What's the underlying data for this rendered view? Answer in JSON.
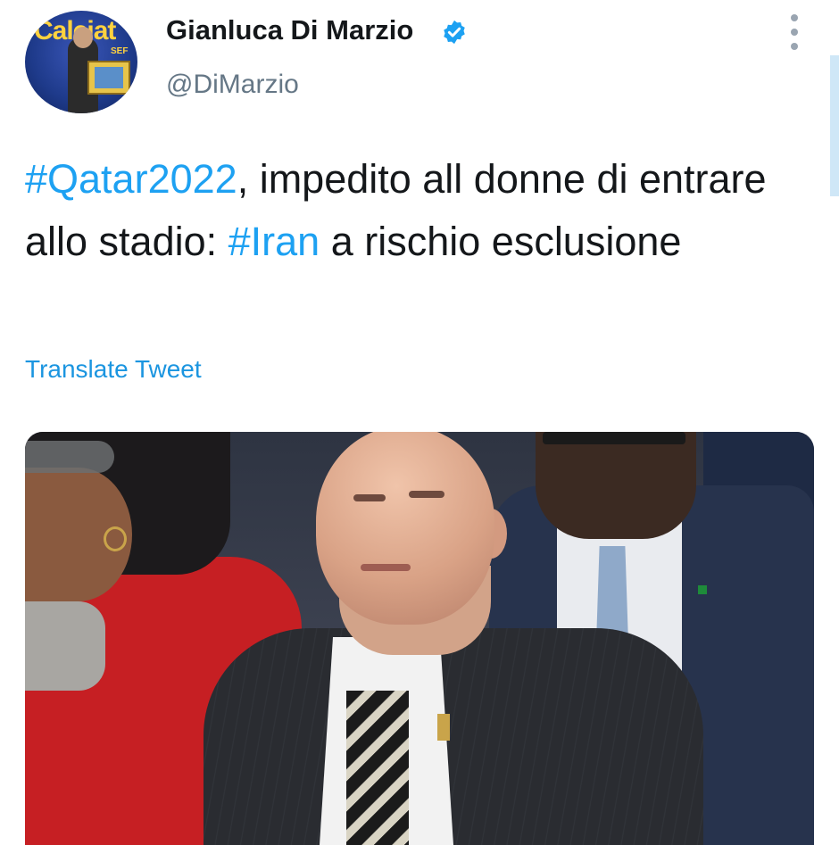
{
  "user": {
    "display_name": "Gianluca Di Marzio",
    "handle": "@DiMarzio",
    "verified": true,
    "avatar_banner_text": "Calciat",
    "avatar_sub_text": "SEF"
  },
  "tweet": {
    "segments": [
      {
        "text": "#Qatar2022",
        "type": "hashtag"
      },
      {
        "text": ", impedito all donne di entrare allo stadio: ",
        "type": "text"
      },
      {
        "text": "#Iran",
        "type": "hashtag"
      },
      {
        "text": " a rischio esclusione",
        "type": "text"
      }
    ],
    "translate_label": "Translate Tweet"
  },
  "icons": {
    "verified": "verified-badge-icon",
    "more": "more-vertical-icon"
  },
  "colors": {
    "link": "#1da1f2",
    "translate": "#1b95e0",
    "text": "#14171a",
    "secondary": "#657786"
  }
}
